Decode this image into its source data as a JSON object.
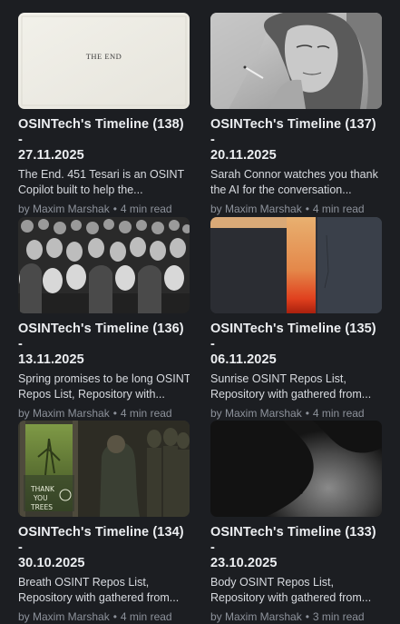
{
  "posts": [
    {
      "title_line1": "OSINTech's Timeline (138) -",
      "title_line2": "27.11.2025",
      "excerpt_line1": "The End. 451 Tesari is an OSINT",
      "excerpt_line2": "Copilot built to help the...",
      "author": "by Maxim Marshak",
      "separator": "•",
      "read_time": "4 min read",
      "image_text": "THE END",
      "image_icon": "the-end-page-image"
    },
    {
      "title_line1": "OSINTech's Timeline (137) -",
      "title_line2": "20.11.2025",
      "excerpt_line1": "Sarah Connor watches you thank",
      "excerpt_line2": "the AI for the conversation...",
      "author": "by Maxim Marshak",
      "separator": "•",
      "read_time": "4 min read",
      "image_icon": "woman-smoking-sketch-image"
    },
    {
      "title_line1": "OSINTech's Timeline (136) -",
      "title_line2": "13.11.2025",
      "excerpt_line1": "Spring promises to be long OSINT",
      "excerpt_line2": "Repos List, Repository with...",
      "author": "by Maxim Marshak",
      "separator": "•",
      "read_time": "4 min read",
      "image_icon": "crowd-of-dolls-image"
    },
    {
      "title_line1": "OSINTech's Timeline (135) -",
      "title_line2": "06.11.2025",
      "excerpt_line1": "Sunrise OSINT Repos List,",
      "excerpt_line2": "Repository with gathered from...",
      "author": "by Maxim Marshak",
      "separator": "•",
      "read_time": "4 min read",
      "image_icon": "abstract-sunrise-image"
    },
    {
      "title_line1": "OSINTech's Timeline (134) -",
      "title_line2": "30.10.2025",
      "excerpt_line1": "Breath OSINT Repos List,",
      "excerpt_line2": "Repository with gathered from...",
      "author": "by Maxim Marshak",
      "separator": "•",
      "read_time": "4 min read",
      "image_text_lines": [
        "THANK",
        "YOU",
        "TREES"
      ],
      "image_icon": "thank-you-trees-image"
    },
    {
      "title_line1": "OSINTech's Timeline (133) -",
      "title_line2": "23.10.2025",
      "excerpt_line1": "Body OSINT Repos List,",
      "excerpt_line2": "Repository with gathered from...",
      "author": "by Maxim Marshak",
      "separator": "•",
      "read_time": "3 min read",
      "image_icon": "dark-body-silhouette-image"
    }
  ],
  "colors": {
    "background": "#1c1e22",
    "title": "#eceef1",
    "excerpt": "#d8dbe0",
    "meta": "#8d929b"
  }
}
